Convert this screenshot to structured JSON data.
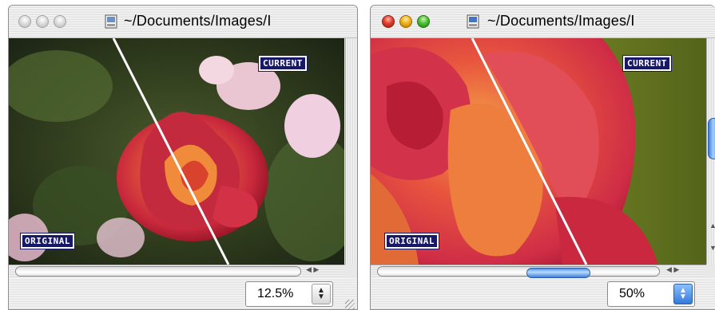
{
  "left_window": {
    "title": "~/Documents/Images/I",
    "label_current": "CURRENT",
    "label_original": "ORIGINAL",
    "zoom_value": "12.5%",
    "active": false
  },
  "right_window": {
    "title": "~/Documents/Images/I",
    "label_current": "CURRENT",
    "label_original": "ORIGINAL",
    "zoom_value": "50%",
    "active": true
  },
  "icons": {
    "traffic_lights": [
      "close-icon",
      "minimize-icon",
      "zoom-icon"
    ],
    "proxy": "document-proxy-icon",
    "stepper": "updown-stepper-icon",
    "resize": "resize-grip-icon"
  },
  "colors": {
    "label_bg": "#181868",
    "accent_blue": "#3378dc",
    "close_red": "#e0402e",
    "minimize_yellow": "#f0b21c",
    "zoom_green": "#4cc236"
  }
}
